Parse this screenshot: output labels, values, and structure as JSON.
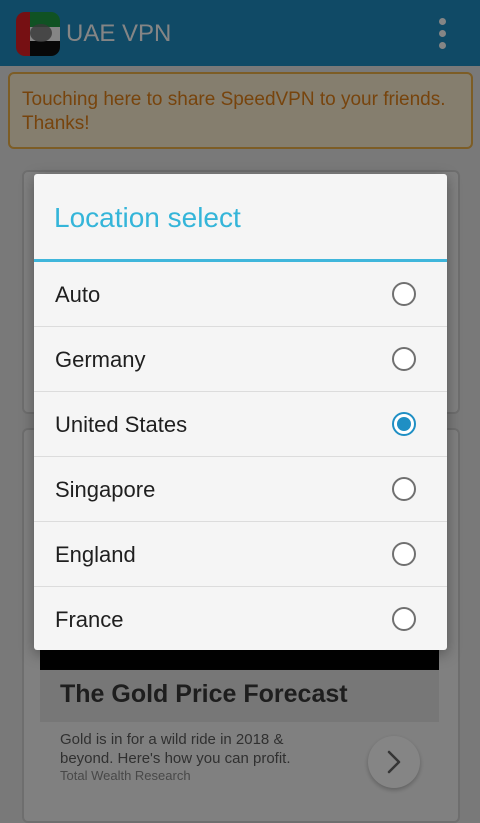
{
  "app": {
    "title": "UAE VPN",
    "icon": "uae-flag-icon",
    "accent": "#1f8fc4"
  },
  "share_banner": {
    "text": "Touching here to share SpeedVPN to your friends. Thanks!"
  },
  "dialog": {
    "title": "Location select",
    "options": [
      {
        "label": "Auto",
        "selected": false
      },
      {
        "label": "Germany",
        "selected": false
      },
      {
        "label": "United States",
        "selected": true
      },
      {
        "label": "Singapore",
        "selected": false
      },
      {
        "label": "England",
        "selected": false
      },
      {
        "label": "France",
        "selected": false
      }
    ]
  },
  "ad": {
    "headline": "The Gold Price Forecast",
    "description": "Gold is in for a wild ride in 2018 & beyond. Here's how you can profit.",
    "advertiser": "Total Wealth Research",
    "cta_icon": "chevron-right-icon"
  }
}
